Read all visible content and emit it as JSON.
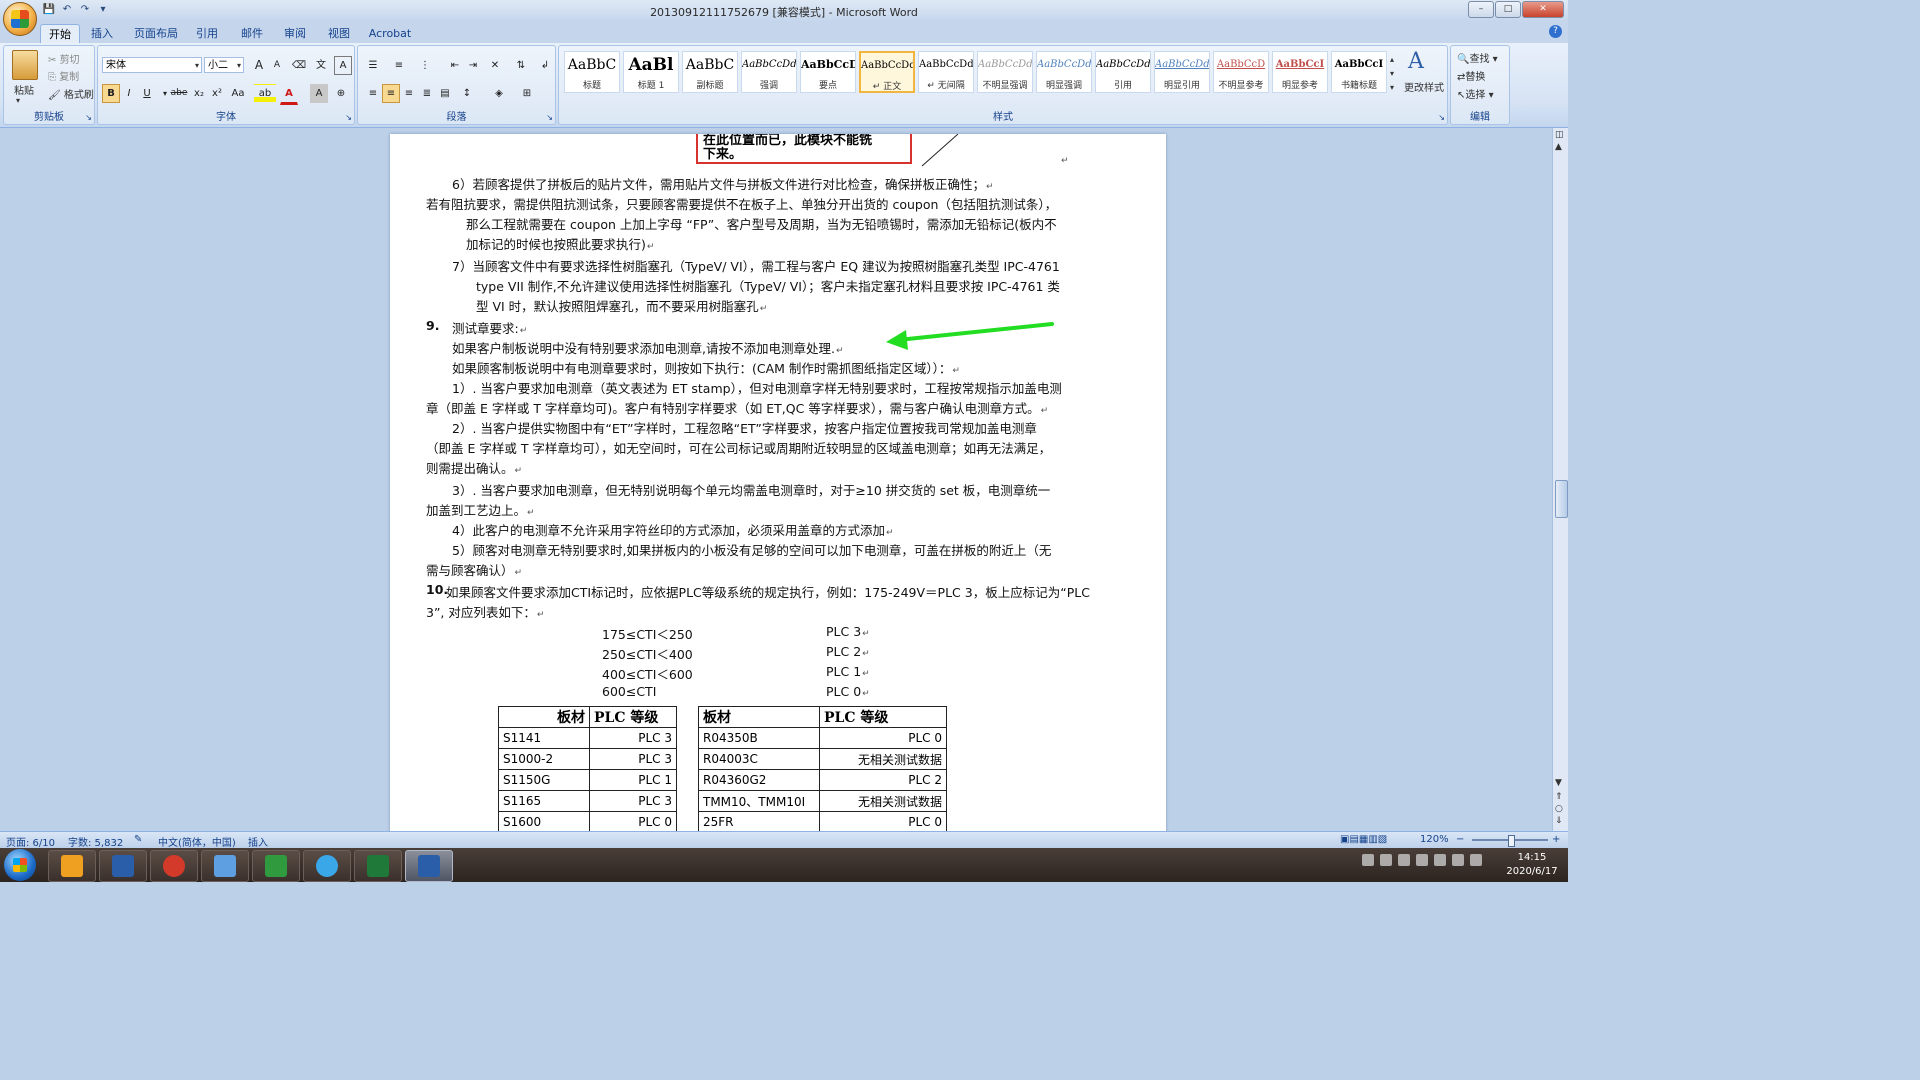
{
  "window": {
    "title": "20130912111752679 [兼容模式] - Microsoft Word",
    "controls": [
      "–",
      "□",
      "✕"
    ]
  },
  "qat": {
    "icons": [
      "save-icon",
      "undo-icon",
      "redo-icon",
      "customize-icon"
    ],
    "glyphs": [
      "💾",
      "↶",
      "↷",
      "▾"
    ]
  },
  "tabs": [
    "开始",
    "插入",
    "页面布局",
    "引用",
    "邮件",
    "审阅",
    "视图",
    "Acrobat"
  ],
  "ribbon": {
    "clipboard": {
      "label": "剪贴板",
      "paste": "粘贴",
      "cut": "剪切",
      "copy": "复制",
      "format_painter": "格式刷"
    },
    "font": {
      "label": "字体",
      "font_name": "宋体",
      "font_size": "小二",
      "bold": "B",
      "italic": "I",
      "underline": "U",
      "strike": "abe",
      "sub": "x₂",
      "sup": "x²",
      "case": "Aa",
      "grow": "A",
      "shrink": "A",
      "clear": "A",
      "color_letter": "A",
      "highlight_letter": "ab"
    },
    "paragraph": {
      "label": "段落"
    },
    "styles": {
      "label": "样式",
      "items": [
        {
          "sample": "AaBbC",
          "name": "标题"
        },
        {
          "sample": "AaBl",
          "name": "标题 1"
        },
        {
          "sample": "AaBbC",
          "name": "副标题"
        },
        {
          "sample": "AaBbCcDd",
          "name": "强调"
        },
        {
          "sample": "AaBbCcD",
          "name": "要点"
        },
        {
          "sample": "AaBbCcDd",
          "name": "↵ 正文"
        },
        {
          "sample": "AaBbCcDd",
          "name": "↵ 无间隔"
        },
        {
          "sample": "AaBbCcDd",
          "name": "不明显强调"
        },
        {
          "sample": "AaBbCcDd",
          "name": "明显强调"
        },
        {
          "sample": "AaBbCcDd",
          "name": "引用"
        },
        {
          "sample": "AaBbCcDd",
          "name": "明显引用"
        },
        {
          "sample": "AaBbCcD",
          "name": "不明显参考"
        },
        {
          "sample": "AaBbCcI",
          "name": "明显参考"
        },
        {
          "sample": "AaBbCcI",
          "name": "书籍标题"
        }
      ],
      "change_styles": "更改样式"
    },
    "editing": {
      "label": "编辑",
      "find": "查找",
      "replace": "替换",
      "select": "选择"
    }
  },
  "document": {
    "callout_lines": [
      "在此位置而已，此模块不能铣",
      "下来。"
    ],
    "lines": [
      "6）若顾客提供了拼板后的贴片文件，需用贴片文件与拼板文件进行对比检查，确保拼板正确性；",
      "若有阻抗要求，需提供阻抗测试条，只要顾客需要提供不在板子上、单独分开出货的 coupon（包括阻抗测试条），",
      "那么工程就需要在 coupon 上加上字母 “FP”、客户型号及周期，当为无铅喷锡时，需添加无铅标记(板内不",
      "加标记的时候也按照此要求执行)",
      "7）当顾客文件中有要求选择性树脂塞孔（TypeV/ VI），需工程与客户 EQ 建议为按照树脂塞孔类型 IPC-4761",
      "type VII  制作,不允许建议使用选择性树脂塞孔（TypeV/ VI）；客户未指定塞孔材料且要求按 IPC-4761 类",
      "型 VI 时，默认按照阻焊塞孔，而不要采用树脂塞孔",
      "9.",
      "测试章要求:",
      "如果客户制板说明中没有特别要求添加电测章,请按不添加电测章处理.",
      "如果顾客制板说明中有电测章要求时，则按如下执行：(CAM 制作时需抓图纸指定区域））：",
      "1）. 当客户要求加电测章（英文表述为 ET stamp），但对电测章字样无特别要求时，工程按常规指示加盖电测",
      "章（即盖 E 字样或 T 字样章均可)。客户有特别字样要求（如 ET,QC 等字样要求），需与客户确认电测章方式。",
      "2）. 当客户提供实物图中有“ET”字样时，工程忽略“ET”字样要求，按客户指定位置按我司常规加盖电测章",
      "（即盖 E 字样或 T 字样章均可），如无空间时，可在公司标记或周期附近较明显的区域盖电测章；如再无法满足，",
      "则需提出确认。",
      "3）. 当客户要求加电测章，但无特别说明每个单元均需盖电测章时，对于≥10 拼交货的 set 板，电测章统一",
      "加盖到工艺边上。",
      "4）此客户的电测章不允许采用字符丝印的方式添加，必须采用盖章的方式添加",
      "5）顾客对电测章无特别要求时,如果拼板内的小板没有足够的空间可以加下电测章，可盖在拼板的附近上（无",
      "需与顾客确认）",
      "10.",
      "如果顾客文件要求添加CTI标记时，应依据PLC等级系统的规定执行，例如：175-249V＝PLC 3，板上应标记为“PLC",
      "3”, 对应列表如下："
    ],
    "cti_ranges": [
      {
        "range": "175≤CTI＜250",
        "plc": "PLC 3"
      },
      {
        "range": "250≤CTI＜400",
        "plc": "PLC 2"
      },
      {
        "range": "400≤CTI＜600",
        "plc": "PLC 1"
      },
      {
        "range": "600≤CTI",
        "plc": "PLC 0"
      }
    ],
    "table_headers": [
      "板材",
      "PLC 等级"
    ],
    "table_left": [
      [
        "S1141",
        "PLC 3"
      ],
      [
        "S1000-2",
        "PLC 3"
      ],
      [
        "S1150G",
        "PLC 1"
      ],
      [
        "S1165",
        "PLC 3"
      ],
      [
        "S1600",
        "PLC 0"
      ]
    ],
    "table_right": [
      [
        "R04350B",
        "PLC 0"
      ],
      [
        "R04003C",
        "无相关测试数据"
      ],
      [
        "R04360G2",
        "PLC 2"
      ],
      [
        "TMM10、TMM10I",
        "无相关测试数据"
      ],
      [
        "25FR",
        "PLC 0"
      ]
    ]
  },
  "statusbar": {
    "page": "页面: 6/10",
    "words": "字数: 5,832",
    "language": "中文(简体，中国)",
    "mode": "插入",
    "zoom": "120%",
    "zoom_minus": "−",
    "zoom_plus": "+"
  },
  "taskbar": {
    "apps": [
      {
        "name": "shell-app",
        "color": "#f0a020"
      },
      {
        "name": "save-app",
        "color": "#2b5ea8"
      },
      {
        "name": "foxit-app",
        "color": "#d33a2a"
      },
      {
        "name": "notepad-app",
        "color": "#5d9fe0"
      },
      {
        "name": "pads-app",
        "color": "#2f9b3e"
      },
      {
        "name": "bird-app",
        "color": "#3aa7e8"
      },
      {
        "name": "excel-app",
        "color": "#1f7a3a"
      },
      {
        "name": "word-app",
        "color": "#2b5ea8"
      }
    ],
    "time": "14:15",
    "date": "2020/6/17"
  },
  "colors": {
    "ribbon_text": "#15428b",
    "callout_border": "#d8322e",
    "arrow": "#22dd22"
  }
}
